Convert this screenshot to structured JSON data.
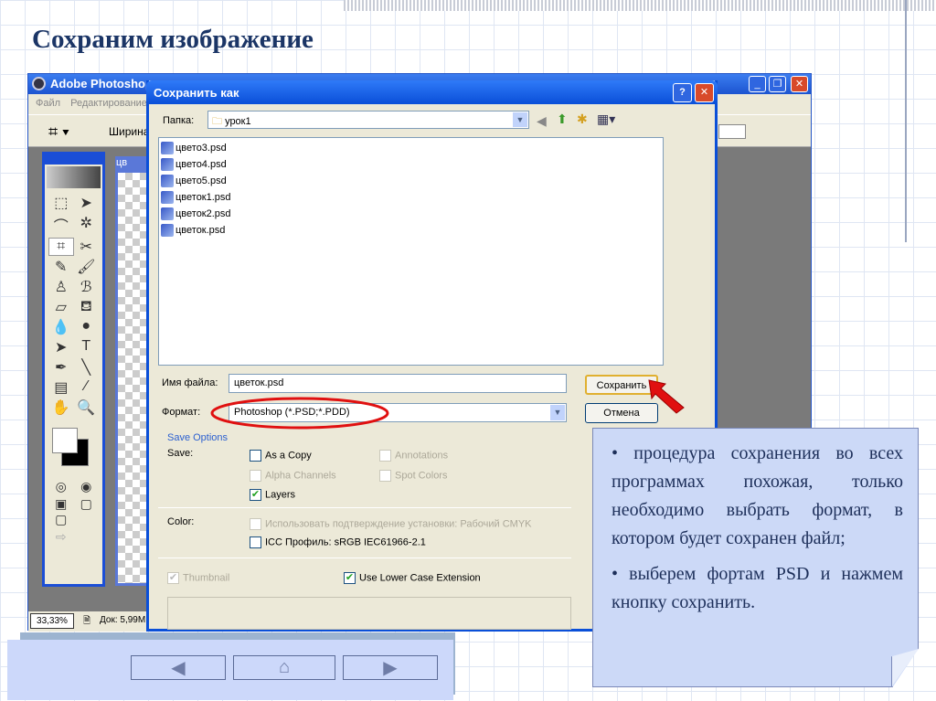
{
  "slide": {
    "title": "Сохраним изображение"
  },
  "photoshop": {
    "title": "Adobe Photoshop",
    "menu": [
      "Файл",
      "Редактирование"
    ],
    "options_label": "Ширина:",
    "zoom": "33,33%",
    "doc_info": "Док: 5,99M",
    "doc_tab": "цв"
  },
  "dialog": {
    "title": "Сохранить как",
    "help": "?",
    "close": "✕",
    "folder_label": "Папка:",
    "folder_value": "урок1",
    "files": [
      "цвето3.psd",
      "цвето4.psd",
      "цвето5.psd",
      "цветок1.psd",
      "цветок2.psd",
      "цветок.psd"
    ],
    "filename_label": "Имя файла:",
    "filename_value": "цветок.psd",
    "format_label": "Формат:",
    "format_value": "Photoshop (*.PSD;*.PDD)",
    "save_button": "Сохранить",
    "cancel_button": "Отмена",
    "save_options": "Save Options",
    "save_label": "Save:",
    "as_copy": "As a Copy",
    "annotations": "Annotations",
    "alpha": "Alpha Channels",
    "spot": "Spot Colors",
    "layers": "Layers",
    "color_label": "Color:",
    "use_proof": "Использовать подтверждение установки:  Рабочий CMYK",
    "icc": "ICC Профиль:  sRGB IEC61966-2.1",
    "thumbnail": "Thumbnail",
    "lower_case": "Use Lower Case Extension"
  },
  "callout": {
    "items": [
      "процедура сохранения во всех программах похожая, только необходимо выбрать формат, в котором будет сохранен файл;",
      "выберем фортам PSD и нажмем кнопку сохранить."
    ]
  },
  "nav": {
    "prev": "◀",
    "home": "⌂",
    "next": "▶"
  },
  "colors": {
    "highlight": "#e01010",
    "accent": "#0a4fd8"
  }
}
